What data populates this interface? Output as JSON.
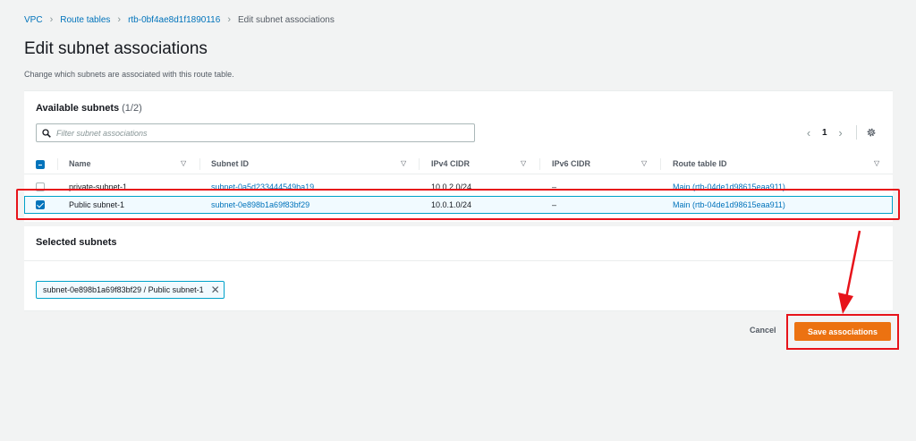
{
  "breadcrumb": {
    "items": [
      "VPC",
      "Route tables",
      "rtb-0bf4ae8d1f1890116"
    ],
    "current": "Edit subnet associations"
  },
  "page": {
    "title": "Edit subnet associations",
    "description": "Change which subnets are associated with this route table."
  },
  "available": {
    "title": "Available subnets",
    "count": "(1/2)",
    "filter_placeholder": "Filter subnet associations",
    "page_number": "1",
    "columns": [
      "Name",
      "Subnet ID",
      "IPv4 CIDR",
      "IPv6 CIDR",
      "Route table ID"
    ],
    "rows": [
      {
        "name": "private-subnet-1",
        "subnet_id": "subnet-0a5d233444549ba19",
        "ipv4": "10.0.2.0/24",
        "ipv6": "–",
        "route_table": "Main (rtb-04de1d98615eaa911)",
        "selected": false
      },
      {
        "name": "Public subnet-1",
        "subnet_id": "subnet-0e898b1a69f83bf29",
        "ipv4": "10.0.1.0/24",
        "ipv6": "–",
        "route_table": "Main (rtb-04de1d98615eaa911)",
        "selected": true
      }
    ]
  },
  "selected_panel": {
    "title": "Selected subnets",
    "token": "subnet-0e898b1a69f83bf29 / Public subnet-1"
  },
  "actions": {
    "cancel": "Cancel",
    "save": "Save associations"
  },
  "colors": {
    "accent": "#0073bb",
    "primary_button": "#ec7211",
    "annotation": "#e7131a"
  }
}
